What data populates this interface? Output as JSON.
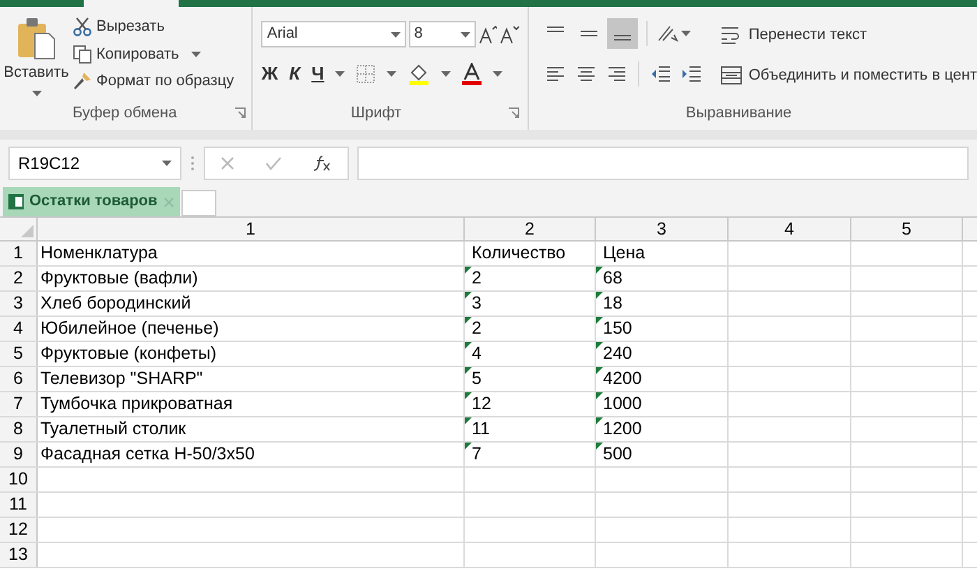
{
  "ribbon": {
    "clipboard": {
      "paste": "Вставить",
      "cut": "Вырезать",
      "copy": "Копировать",
      "format_painter": "Формат по образцу",
      "label": "Буфер обмена"
    },
    "font": {
      "name": "Arial",
      "size": "8",
      "bold": "Ж",
      "italic": "К",
      "underline": "Ч",
      "label": "Шрифт"
    },
    "alignment": {
      "vertical_align": [
        {
          "selected": false
        },
        {
          "selected": false
        },
        {
          "selected": true
        }
      ],
      "wrap_text": "Перенести текст",
      "merge": "Объединить и поместить в цент",
      "label": "Выравнивание"
    }
  },
  "name_box": "R19C12",
  "sheet_tabs": [
    {
      "label": "Остатки товаров",
      "selected": true
    }
  ],
  "columns": [
    "1",
    "2",
    "3",
    "4",
    "5"
  ],
  "rows": [
    {
      "number": "1",
      "cells": [
        "Номенклатура",
        "Количество",
        "Цена"
      ],
      "error_marks": false
    },
    {
      "number": "2",
      "cells": [
        "Фруктовые (вафли)",
        "2",
        "68"
      ],
      "error_marks": true
    },
    {
      "number": "3",
      "cells": [
        "Хлеб бородинский",
        "3",
        "18"
      ],
      "error_marks": true
    },
    {
      "number": "4",
      "cells": [
        "Юбилейное (печенье)",
        "2",
        "150"
      ],
      "error_marks": true
    },
    {
      "number": "5",
      "cells": [
        "Фруктовые (конфеты)",
        "4",
        "240"
      ],
      "error_marks": true
    },
    {
      "number": "6",
      "cells": [
        "Телевизор \"SHARP\"",
        "5",
        "4200"
      ],
      "error_marks": true
    },
    {
      "number": "7",
      "cells": [
        "Тумбочка прикроватная",
        "12",
        "1000"
      ],
      "error_marks": true
    },
    {
      "number": "8",
      "cells": [
        "Туалетный столик",
        "11",
        "1200"
      ],
      "error_marks": true
    },
    {
      "number": "9",
      "cells": [
        "Фасадная сетка Н-50/3х50",
        "7",
        "500"
      ],
      "error_marks": true
    },
    {
      "number": "10",
      "cells": [],
      "error_marks": false
    },
    {
      "number": "11",
      "cells": [],
      "error_marks": false
    },
    {
      "number": "12",
      "cells": [],
      "error_marks": false
    },
    {
      "number": "13",
      "cells": [],
      "error_marks": false
    }
  ]
}
